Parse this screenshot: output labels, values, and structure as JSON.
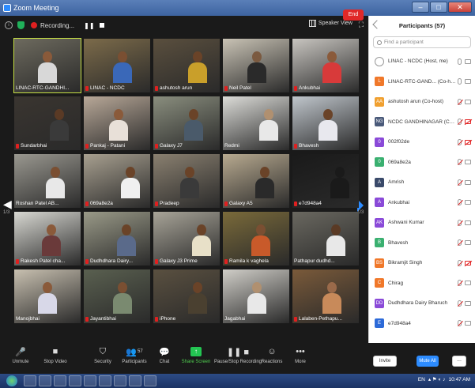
{
  "window": {
    "title": "Zoom Meeting",
    "minimize": "–",
    "maximize": "□",
    "close": "✕"
  },
  "meeting_bar": {
    "recording_label": "Recording...",
    "pause": "❚❚",
    "speaker_view": "Speaker View",
    "fullscreen": "⛶"
  },
  "pagination": {
    "left_page": "1/3",
    "right_page": "1/3"
  },
  "tiles": [
    {
      "name": "LINAC-RTC-GANDHI...",
      "muted": false,
      "bg": "#6d6a5e",
      "skin": "#8a5a3a",
      "shirt": "#d8d8d8",
      "active": true
    },
    {
      "name": "LINAC - NCDC",
      "muted": true,
      "bg": "#7c6b4a",
      "skin": "#7a4f32",
      "shirt": "#3a68b8"
    },
    {
      "name": "ashutosh arun",
      "muted": true,
      "bg": "#5a4f3e",
      "skin": "#6a4328",
      "shirt": "#c99f2a"
    },
    {
      "name": "Neil Patel",
      "muted": true,
      "bg": "#c9c3b5",
      "skin": "#7b5a40",
      "shirt": "#2a2a2a"
    },
    {
      "name": "Ankubhai",
      "muted": true,
      "bg": "#c8c5c0",
      "skin": "#8a5a3a",
      "shirt": "#d83a3a"
    },
    {
      "name": "Sundarbhai",
      "muted": true,
      "bg": "#3a3530",
      "skin": "#5a3a25",
      "shirt": "#3a3a3a"
    },
    {
      "name": "Pankaj - Patani",
      "muted": true,
      "bg": "#b8a898",
      "skin": "#8a5a3a",
      "shirt": "#e8e0d8"
    },
    {
      "name": "Galaxy J7",
      "muted": true,
      "bg": "#8a8e7e",
      "skin": "#6a4328",
      "shirt": "#4a5a6a"
    },
    {
      "name": "Redmi",
      "muted": false,
      "bg": "#dcdcd8",
      "skin": "#b09070",
      "shirt": "#e8e8e8"
    },
    {
      "name": "Bhavesh",
      "muted": true,
      "bg": "#c0c6cc",
      "skin": "#6a4328",
      "shirt": "#e8e8ee"
    },
    {
      "name": "Roshan Patel AB...",
      "muted": false,
      "bg": "#9a9890",
      "skin": "#7a4f32",
      "shirt": "#e8e8e8"
    },
    {
      "name": "069a8e2a",
      "muted": true,
      "bg": "#a8a090",
      "skin": "#6a4328",
      "shirt": "#f0f0f0"
    },
    {
      "name": "Pradeep",
      "muted": true,
      "bg": "#8a8070",
      "skin": "#6a4328",
      "shirt": "#3a3a3a"
    },
    {
      "name": "Galaxy A5",
      "muted": true,
      "bg": "#b8aa90",
      "skin": "#6a4328",
      "shirt": "#2a2a2a"
    },
    {
      "name": "e7d948a4",
      "muted": true,
      "bg": "#1a1a1a",
      "skin": "#1a1a1a",
      "shirt": "#1a1a1a"
    },
    {
      "name": "Rakesh Patel cha...",
      "muted": true,
      "bg": "#d8d8d2",
      "skin": "#8a5a3a",
      "shirt": "#6a3a3a"
    },
    {
      "name": "Dudhdhara Dairy...",
      "muted": true,
      "bg": "#9a9a88",
      "skin": "#6a4328",
      "shirt": "#5a6a8a"
    },
    {
      "name": "Galaxy J3 Prime",
      "muted": true,
      "bg": "#a8a498",
      "skin": "#6a4328",
      "shirt": "#e8e0c8"
    },
    {
      "name": "Ramila k vaghela",
      "muted": true,
      "bg": "#7a6a3a",
      "skin": "#7a4f32",
      "shirt": "#c85a2a"
    },
    {
      "name": "Pathapur dudhd...",
      "muted": false,
      "bg": "#6a6860",
      "skin": "#5a3a25",
      "shirt": "#e8e8e8"
    },
    {
      "name": "Manojbhai",
      "muted": false,
      "bg": "#c8c0b0",
      "skin": "#8a5a3a",
      "shirt": "#d8d8e8"
    },
    {
      "name": "Jayantibhai",
      "muted": true,
      "bg": "#5a6050",
      "skin": "#7a4f32",
      "shirt": "#7a8a70"
    },
    {
      "name": "iPhone",
      "muted": true,
      "bg": "#5a5040",
      "skin": "#6a4328",
      "shirt": "#4a4030"
    },
    {
      "name": "Jagabhai",
      "muted": false,
      "bg": "#d0cec8",
      "skin": "#b09070",
      "shirt": "#e8e8e8"
    },
    {
      "name": "Lalaben-Pethapu...",
      "muted": true,
      "bg": "#7a5a3a",
      "skin": "#9a6a4a",
      "shirt": "#c88a5a"
    }
  ],
  "toolbar": [
    {
      "id": "unmute",
      "label": "Unmute",
      "icon": "🎤"
    },
    {
      "id": "stop-video",
      "label": "Stop Video",
      "icon": "■"
    },
    {
      "id": "security",
      "label": "Security",
      "icon": "⛉"
    },
    {
      "id": "participants",
      "label": "Participants",
      "icon": "👥",
      "count": "57"
    },
    {
      "id": "chat",
      "label": "Chat",
      "icon": "💬"
    },
    {
      "id": "share-screen",
      "label": "Share Screen",
      "icon": "↑"
    },
    {
      "id": "pause-recording",
      "label": "Pause/Stop Recording",
      "icon": "❚❚ ■"
    },
    {
      "id": "reactions",
      "label": "Reactions",
      "icon": "☺"
    },
    {
      "id": "more",
      "label": "More",
      "icon": "•••"
    }
  ],
  "end_label": "End",
  "panel": {
    "title": "Participants (57)",
    "search_placeholder": "Find a participant",
    "participants": [
      {
        "name": "LINAC - NCDC (Host, me)",
        "avatar": "",
        "color": "#ffffff",
        "mic": "on",
        "cam": "on"
      },
      {
        "name": "LINAC-RTC-GAND... (Co-host)",
        "avatar": "L",
        "color": "#f0782a",
        "mic": "on",
        "cam": "on"
      },
      {
        "name": "ashutosh arun (Co-host)",
        "avatar": "AA",
        "color": "#f0a030",
        "mic": "muted",
        "cam": "on"
      },
      {
        "name": "NCDC GANDHINAGAR (Co-host)",
        "avatar": "NG",
        "color": "#4a5a7a",
        "mic": "muted",
        "cam": "off"
      },
      {
        "name": "002f02de",
        "avatar": "0",
        "color": "#8a4ad8",
        "mic": "muted",
        "cam": "off"
      },
      {
        "name": "069a8e2a",
        "avatar": "0",
        "color": "#3ab070",
        "mic": "muted",
        "cam": "on"
      },
      {
        "name": "Amrish",
        "avatar": "A",
        "color": "#3a4a6a",
        "mic": "muted",
        "cam": "on"
      },
      {
        "name": "Ankubhai",
        "avatar": "A",
        "color": "#8a4ad8",
        "mic": "muted",
        "cam": "on"
      },
      {
        "name": "Ashwani Kumar",
        "avatar": "AK",
        "color": "#8a4ad8",
        "mic": "muted",
        "cam": "on"
      },
      {
        "name": "Bhavesh",
        "avatar": "B",
        "color": "#3ab070",
        "mic": "muted",
        "cam": "on"
      },
      {
        "name": "Bikramjit Singh",
        "avatar": "BS",
        "color": "#f0782a",
        "mic": "muted",
        "cam": "off"
      },
      {
        "name": "Chirag",
        "avatar": "C",
        "color": "#f0782a",
        "mic": "muted",
        "cam": "on"
      },
      {
        "name": "Dudhdhara Dairy Bharuch",
        "avatar": "DD",
        "color": "#8a4ad8",
        "mic": "muted",
        "cam": "on"
      },
      {
        "name": "e7d948a4",
        "avatar": "E",
        "color": "#2d6ad8",
        "mic": "muted",
        "cam": "on"
      }
    ],
    "invite": "Invite",
    "mute_all": "Mute All",
    "more": "..."
  },
  "taskbar": {
    "lang": "EN",
    "time": "10:47 AM"
  }
}
